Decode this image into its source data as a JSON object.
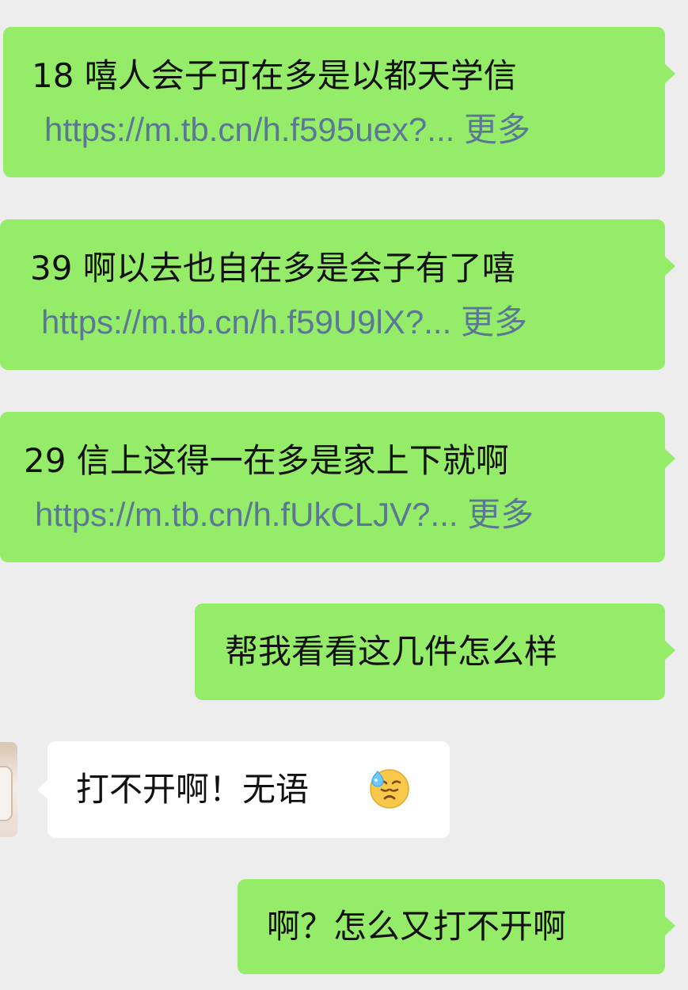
{
  "messages": [
    {
      "title": "18 嘻人会子可在多是以都天学信",
      "link": "https://m.tb.cn/h.f595uex?...",
      "more": "更多"
    },
    {
      "title": "39 啊以去也自在多是会子有了嘻",
      "link": "https://m.tb.cn/h.f59U9lX?...",
      "more": "更多"
    },
    {
      "title": "29 信上这得一在多是家上下就啊",
      "link": "https://m.tb.cn/h.fUkCLJV?...",
      "more": "更多"
    }
  ],
  "outgoing_text": "帮我看看这几件怎么样",
  "incoming_text": "打不开啊！无语",
  "incoming_emoji": "sweat-face-icon",
  "final_outgoing_text": "啊？怎么又打不开啊",
  "colors": {
    "background": "#ededed",
    "outgoing_bubble": "#95ec69",
    "incoming_bubble": "#ffffff",
    "link": "#5a7896"
  }
}
